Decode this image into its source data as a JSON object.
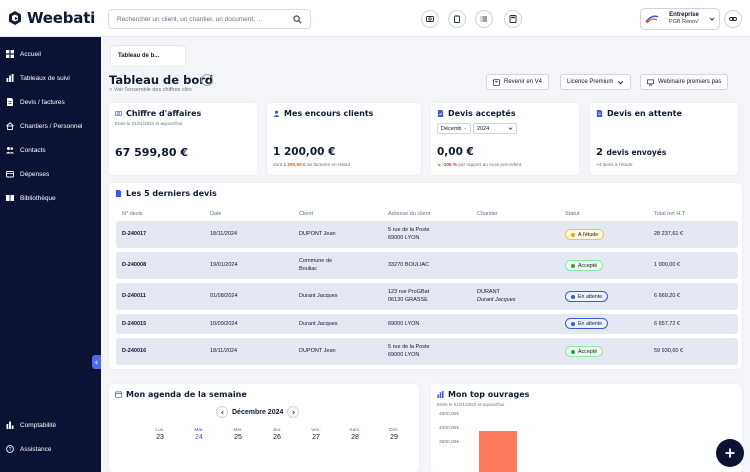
{
  "app": {
    "name": "Weebati"
  },
  "header": {
    "search_placeholder": "Rechercher un client, un chantier, un document, ...",
    "company": {
      "type": "Entreprise",
      "name": "PGB Renov'"
    }
  },
  "sidebar": {
    "items": [
      {
        "label": "Accueil",
        "icon": "grid-icon"
      },
      {
        "label": "Tableaux de suivi",
        "icon": "chart-icon"
      },
      {
        "label": "Devis / factures",
        "icon": "document-icon"
      },
      {
        "label": "Chantiers / Personnel",
        "icon": "house-icon"
      },
      {
        "label": "Contacts",
        "icon": "users-icon"
      },
      {
        "label": "Dépenses",
        "icon": "wallet-icon"
      },
      {
        "label": "Bibliothèque",
        "icon": "book-icon"
      }
    ],
    "bottom": [
      {
        "label": "Comptabilité",
        "icon": "bars-icon"
      },
      {
        "label": "Assistance",
        "icon": "help-icon"
      }
    ]
  },
  "tabs": [
    {
      "label": "Tableau de b..."
    }
  ],
  "page": {
    "title": "Tableau de bord",
    "sublink": "> Voir l'ensemble des chiffres clés",
    "buttons": {
      "revenir": "Revenir en V4",
      "licence": "Licence Premium",
      "webinaire": "Webinaire premiers pas"
    }
  },
  "cards": {
    "ca": {
      "title": "Chiffre d'affaires",
      "sub": "Entre le 01/01/2024 et aujourd'hui",
      "value": "67 599,80 €"
    },
    "encours": {
      "title": "Mes encours clients",
      "value": "1 200,00 €",
      "note_pre": "dont",
      "note_amount": "1 200,00 €",
      "note_post": "de factures en retard"
    },
    "acceptes": {
      "title": "Devis acceptés",
      "month": "Décemb",
      "year": "2024",
      "value": "0,00 €",
      "note_pct": "↘ -100 %",
      "note_post": "par rapport au mois précédent"
    },
    "attente": {
      "title": "Devis en attente",
      "count": "2",
      "count_label": "devis envoyés",
      "note_plus": "+4",
      "note_post": "devis à l'étude"
    }
  },
  "devis": {
    "title": "Les 5 derniers devis",
    "columns": [
      "N° devis",
      "Date",
      "Client",
      "Adresse du client",
      "Chantier",
      "Statut",
      "Total net H.T"
    ],
    "rows": [
      {
        "num": "D-240017",
        "date": "18/11/2024",
        "client": [
          "DUPONT Jean"
        ],
        "adresse": [
          "5 rue de la Poste",
          "69000 LYON"
        ],
        "chantier": [],
        "statut": "A l'étude",
        "total": "28 237,61 €"
      },
      {
        "num": "D-240008",
        "date": "19/01/2024",
        "client": [
          "Commune de",
          "Bouliac"
        ],
        "adresse": [
          "33270 BOULIAC"
        ],
        "chantier": [],
        "statut": "Accepté",
        "total": "1 000,00 €"
      },
      {
        "num": "D-240011",
        "date": "01/08/2024",
        "client": [
          "Durant Jacques"
        ],
        "adresse": [
          "123 rue ProGBat",
          "06130 GRASSE"
        ],
        "chantier": [
          "DURANT",
          "Durant Jacques"
        ],
        "statut": "En attente",
        "total": "6 669,20 €"
      },
      {
        "num": "D-240015",
        "date": "10/09/2024",
        "client": [
          "Durant Jacques"
        ],
        "adresse": [
          "69000 LYON"
        ],
        "chantier": [],
        "statut": "En attente",
        "total": "6 657,72 €"
      },
      {
        "num": "D-240016",
        "date": "18/11/2024",
        "client": [
          "DUPONT Jean"
        ],
        "adresse": [
          "5 rue de la Poste",
          "69000 LYON"
        ],
        "chantier": [],
        "statut": "Accepté",
        "total": "59 930,60 €"
      }
    ]
  },
  "agenda": {
    "title": "Mon agenda de la semaine",
    "month": "Décembre 2024",
    "days": [
      {
        "name": "Lun.",
        "num": "23"
      },
      {
        "name": "Mar.",
        "num": "24"
      },
      {
        "name": "Mer.",
        "num": "25"
      },
      {
        "name": "Jeu.",
        "num": "26"
      },
      {
        "name": "Ven.",
        "num": "27"
      },
      {
        "name": "Sam.",
        "num": "28"
      },
      {
        "name": "Dim.",
        "num": "29"
      }
    ]
  },
  "ouvrages": {
    "title": "Mon top ouvrages",
    "sub": "Entre le 01/01/2023 et aujourd'hui",
    "y_ticks": [
      "4500,00€",
      "4000,00€",
      "3500,00€"
    ]
  },
  "colors": {
    "sidebar": "#0b1233",
    "accent": "#3b5bdb",
    "row_bg": "#e4e8f3",
    "status_etude": "#f0a500",
    "status_accepte": "#2f9e44",
    "status_attente": "#3b5bdb",
    "chart_bar": "#ff7a5c"
  }
}
